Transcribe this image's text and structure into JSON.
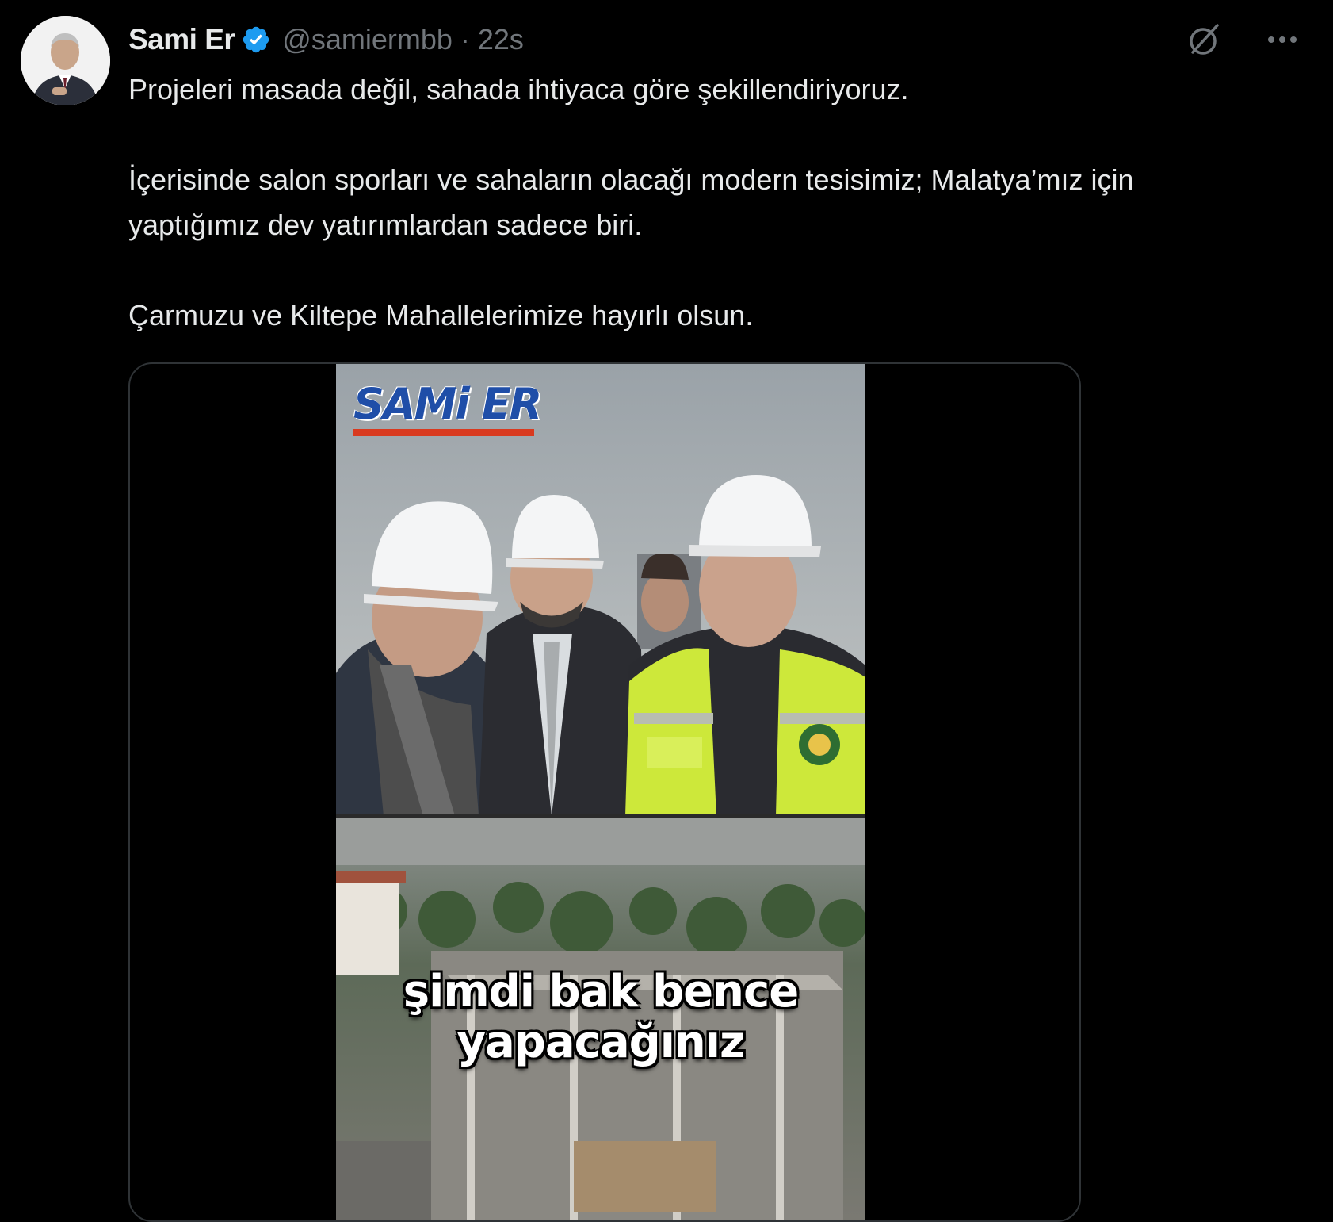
{
  "author": {
    "display_name": "Sami Er",
    "handle": "@samiermbb",
    "separator": "·",
    "time": "22s",
    "verified": true
  },
  "header_icons": {
    "grok": "grok-icon",
    "more": "more-icon"
  },
  "tweet": {
    "paragraphs": [
      "Projeleri masada değil, sahada ihtiyaca göre şekillendiriyoruz.",
      "İçerisinde salon sporları ve sahaların olacağı modern tesisimiz; Malatya’mız için",
      "yaptığımız dev yatırımlardan sadece biri.",
      "Çarmuzu ve Kiltepe Mahallelerimize hayırlı olsun."
    ]
  },
  "media": {
    "type": "video",
    "brand_logo": "SAMi ER",
    "caption_line1": "şimdi bak bence",
    "caption_line2": "yapacağınız"
  },
  "colors": {
    "background": "#000000",
    "text": "#e7e9ea",
    "secondary": "#71767b",
    "verified": "#1d9bf0",
    "border": "#2f3336"
  }
}
